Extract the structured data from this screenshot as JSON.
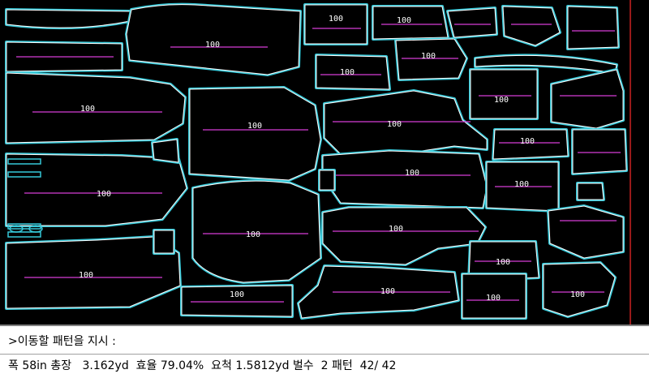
{
  "colors": {
    "background": "#000000",
    "outline": "#36c8d8",
    "line": "#ffffff",
    "grain": "#d63cd6",
    "marker_label": "#ffffff",
    "end_line": "#cc2222"
  },
  "pieces": {
    "common_label": "100"
  },
  "command": {
    "prompt": ">이동할 패턴을 지시 :"
  },
  "status": {
    "text": "폭 58in 총장   3.162yd  효율 79.04%  요척 1.5812yd 벌수  2 패턴  42/ 42"
  }
}
